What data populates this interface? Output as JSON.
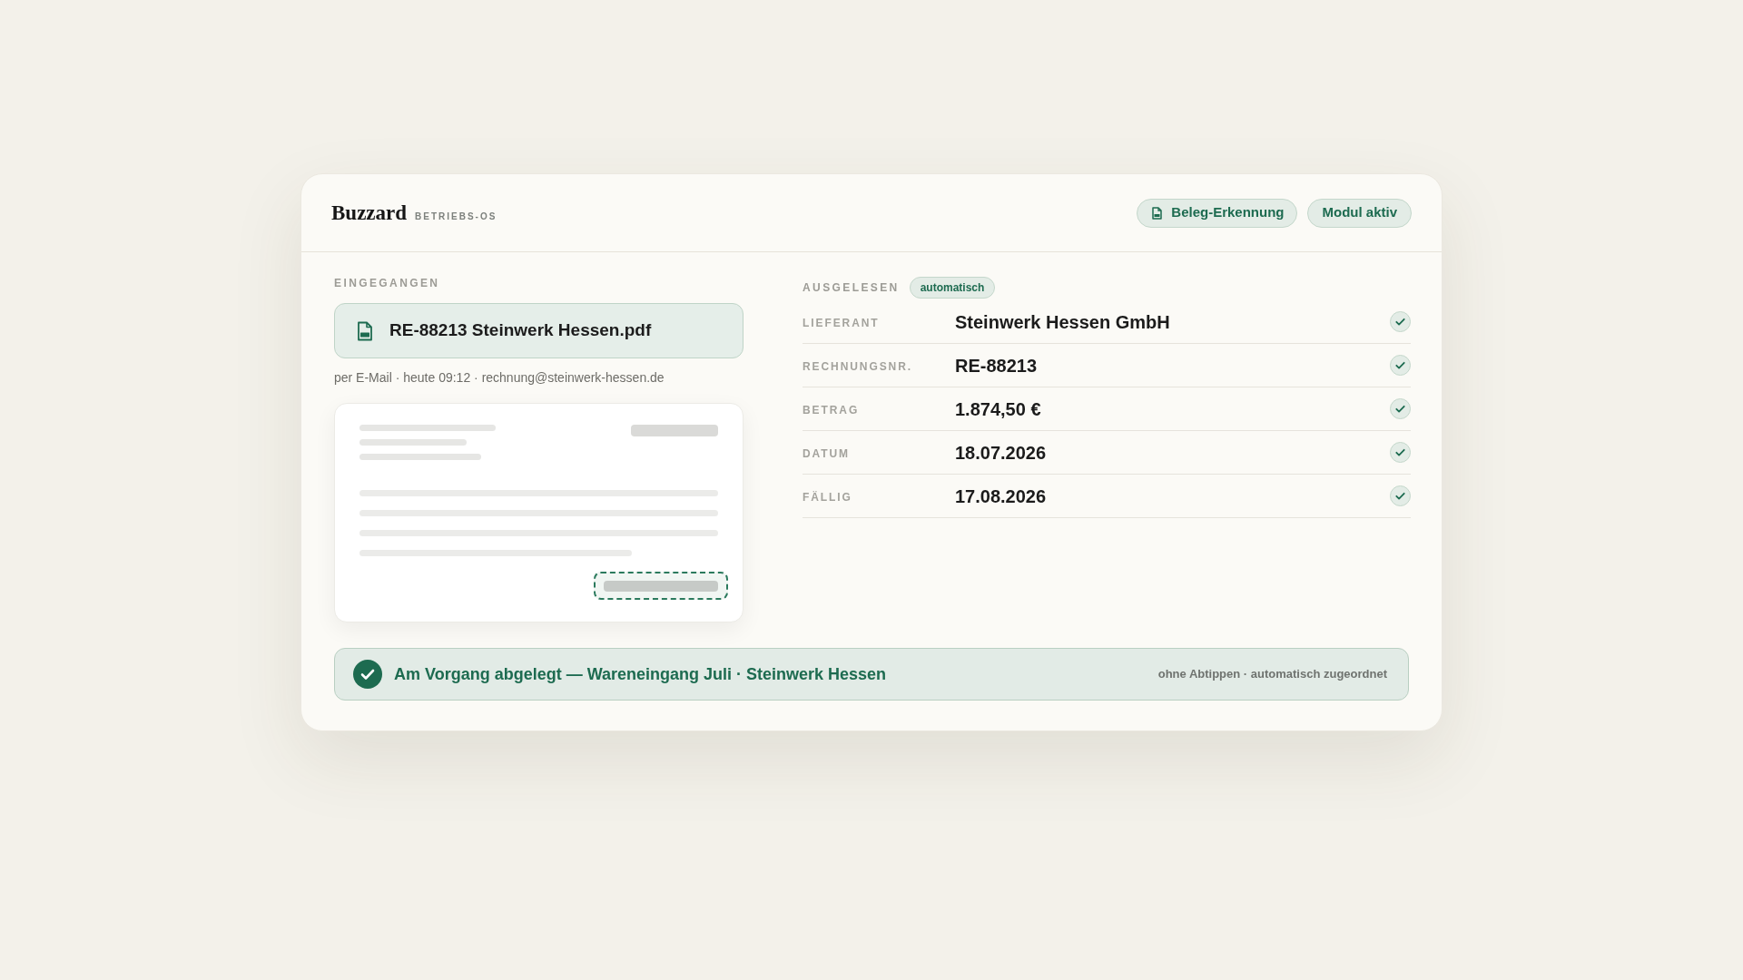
{
  "header": {
    "logo": "Buzzard",
    "subtitle": "BETRIEBS-OS",
    "pills": [
      {
        "label": "Beleg-Erkennung",
        "kind": "icon"
      },
      {
        "label": "Modul aktiv",
        "kind": "text"
      }
    ]
  },
  "received": {
    "heading": "EINGEGANGEN",
    "file_name": "RE-88213 Steinwerk Hessen.pdf",
    "meta": "per E-Mail · heute 09:12 · rechnung@steinwerk-hessen.de"
  },
  "extracted": {
    "heading": "AUSGELESEN",
    "badge": "automatisch",
    "fields": [
      {
        "label": "LIEFERANT",
        "value": "Steinwerk Hessen GmbH",
        "verified": true
      },
      {
        "label": "RECHNUNGSNR.",
        "value": "RE-88213",
        "verified": true
      },
      {
        "label": "BETRAG",
        "value": "1.874,50 €",
        "verified": true
      },
      {
        "label": "DATUM",
        "value": "18.07.2026",
        "verified": true
      },
      {
        "label": "FÄLLIG",
        "value": "17.08.2026",
        "verified": true
      }
    ]
  },
  "status_banner": {
    "message": "Am Vorgang abgelegt — Wareneingang Juli · Steinwerk Hessen",
    "note": "ohne Abtippen · automatisch zugeordnet"
  }
}
